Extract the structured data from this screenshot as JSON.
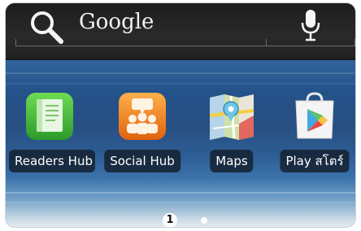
{
  "search_bar": {
    "label": "Google",
    "search_icon": "search-icon",
    "mic_icon": "microphone-icon"
  },
  "apps": [
    {
      "label": "Readers Hub",
      "icon": "readers-hub-icon"
    },
    {
      "label": "Social Hub",
      "icon": "social-hub-icon"
    },
    {
      "label": "Maps",
      "icon": "maps-icon"
    },
    {
      "label": "Play สโตร์",
      "icon": "play-store-icon"
    }
  ],
  "page_indicator": {
    "active_page": "1",
    "page_count": 2
  },
  "colors": {
    "search_bar_bg": "#222222",
    "label_bg": "#141e2d",
    "readers_green": "#3fb83a",
    "social_orange": "#f07a1c"
  }
}
